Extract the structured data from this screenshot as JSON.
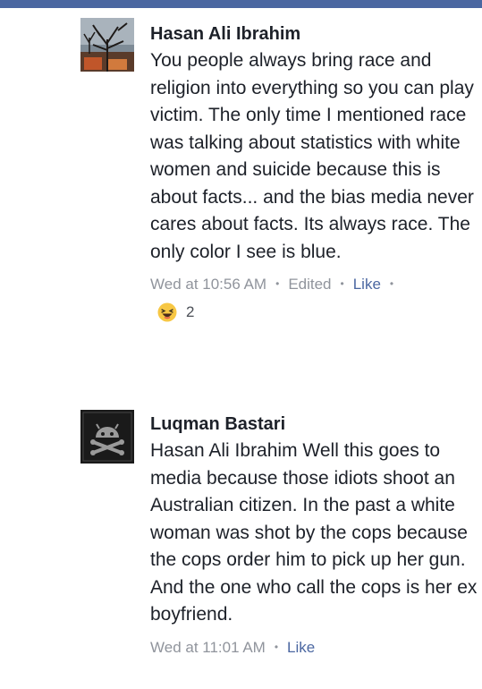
{
  "comments": [
    {
      "author": "Hasan Ali Ibrahim",
      "text": "You people always bring race and religion into everything so you can play victim. The only time I mentioned race was talking about statistics with white women and suicide because this is about facts... and the bias media never cares about facts. Its always race. The only color I see is blue.",
      "timestamp": "Wed at 10:56 AM",
      "edited_label": "Edited",
      "like_label": "Like",
      "reaction_icon": "laughing-face-icon",
      "reaction_count": "2"
    },
    {
      "author": "Luqman Bastari",
      "text": "Hasan Ali Ibrahim Well this goes to media because those idiots shoot an Australian citizen. In the past a white woman was shot by the cops because the cops order him to pick up her gun. And the one who call the cops is her ex boyfriend.",
      "timestamp": "Wed at 11:01 AM",
      "like_label": "Like"
    }
  ],
  "colors": {
    "top_bar": "#4b67a1",
    "author": "#1d2129",
    "meta_grey": "#90949c",
    "link_blue": "#4b67a1"
  }
}
